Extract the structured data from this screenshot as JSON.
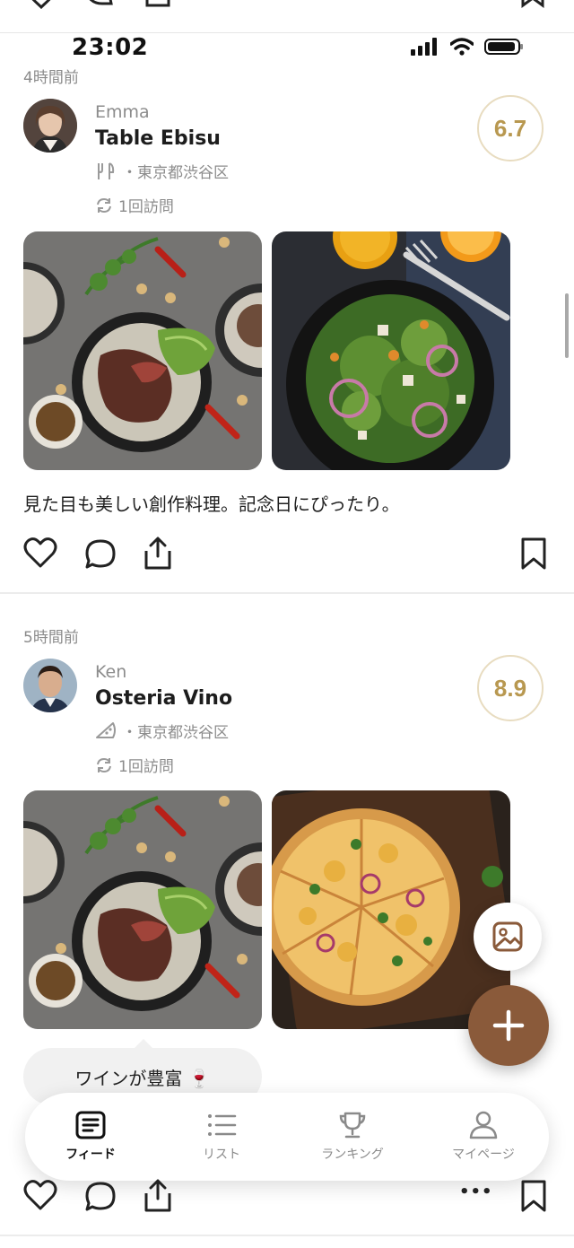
{
  "status_bar": {
    "time": "23:02"
  },
  "posts": [
    {
      "time_ago": "4時間前",
      "user": "Emma",
      "restaurant": "Table Ebisu",
      "location": "・東京都渋谷区",
      "visits": "1回訪問",
      "score": "6.7",
      "caption": "見た目も美しい創作料理。記念日にぴったり。",
      "category_icon": "fork-knife-icon"
    },
    {
      "time_ago": "5時間前",
      "user": "Ken",
      "restaurant": "Osteria Vino",
      "location": "・東京都渋谷区",
      "visits": "1回訪問",
      "score": "8.9",
      "tag": "ワインが豊富 🍷",
      "category_icon": "pizza-icon"
    }
  ],
  "tabs": [
    {
      "label": "フィード",
      "icon": "feed-icon",
      "active": true
    },
    {
      "label": "リスト",
      "icon": "list-icon",
      "active": false
    },
    {
      "label": "ランキング",
      "icon": "trophy-icon",
      "active": false
    },
    {
      "label": "マイページ",
      "icon": "profile-icon",
      "active": false
    }
  ],
  "more_label": "•••",
  "colors": {
    "accent": "#8a5a3a",
    "score_gold": "#b89850",
    "score_ring": "#e8dcc0"
  }
}
